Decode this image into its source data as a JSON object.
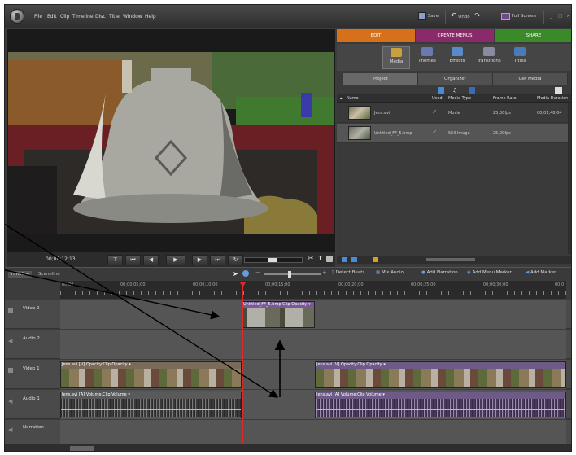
{
  "menu": [
    "File",
    "Edit",
    "Clip",
    "Timeline",
    "Disc",
    "Title",
    "Window",
    "Help"
  ],
  "toolbar": {
    "save": "Save",
    "undo": "Undo",
    "fullscreen": "Full Screen"
  },
  "monitor": {
    "timecode": "00;00;12;13"
  },
  "tabs": {
    "edit": "EDIT",
    "create_menus": "CREATE MENUS",
    "share": "SHARE"
  },
  "subtabs": [
    "Media",
    "Themes",
    "Effects",
    "Transitions",
    "Titles"
  ],
  "panel_tabs": [
    "Project",
    "Organizer",
    "Get Media"
  ],
  "media_table": {
    "headers": [
      "Name",
      "Used",
      "Media Type",
      "Frame Rate",
      "Media Duration"
    ],
    "rows": [
      {
        "name": "Jens.avi",
        "type": "Movie",
        "rate": "25,00fps",
        "duration": "00;01;48;04"
      },
      {
        "name": "Untitled_FF_5.bmp",
        "type": "Still Image",
        "rate": "25,00fps",
        "duration": ""
      }
    ]
  },
  "timeline": {
    "tabs": [
      "Timeline",
      "Sceneline"
    ],
    "tools": [
      "Detect Beats",
      "Mix Audio",
      "Add Narration",
      "Add Menu Marker",
      "Add Marker"
    ],
    "ruler": [
      "00;00",
      "00;00;05;00",
      "00;00;10;00",
      "00;00;15;00",
      "00;00;20;00",
      "00;00;25;00",
      "00;00;30;00",
      "00;0"
    ],
    "tracks": [
      "Video 2",
      "Audio 2",
      "Video 1",
      "Audio 1",
      "Narration"
    ],
    "clips": {
      "still": "Untitled_FF_5.bmp  Clip Opacity ▾",
      "v1a": "Jens.avi [V]  Opacity:Clip Opacity ▾",
      "a1a": "Jens.avi [A]  Volume:Clip Volume ▾",
      "v1b": "Jens.avi [V]  Opacity:Clip Opacity ▾",
      "a1b": "Jens.avi [A]  Volume:Clip Volume ▾"
    }
  },
  "colors": {
    "edit": "#e07a10",
    "create_menus": "#8a2a6a",
    "share": "#3a8a2a",
    "playhead": "#e0282a"
  }
}
